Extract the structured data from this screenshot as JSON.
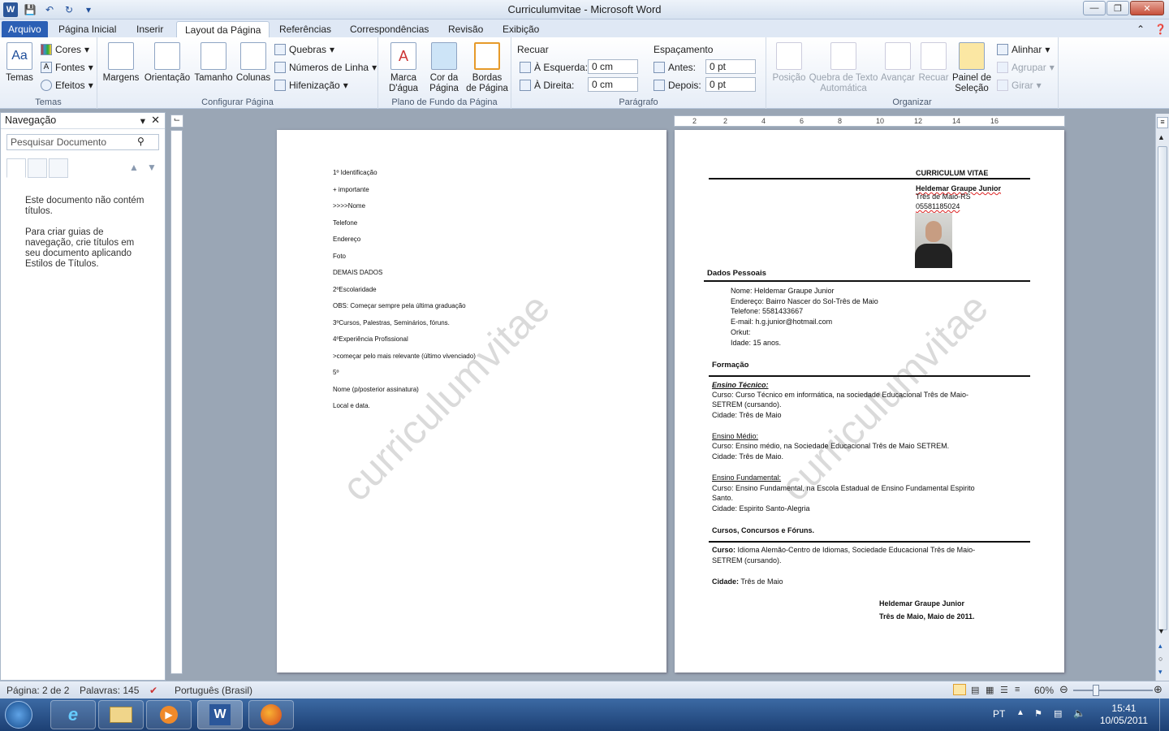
{
  "window": {
    "title": "Curriculumvitae - Microsoft Word"
  },
  "tabs": [
    {
      "label": "Arquivo"
    },
    {
      "label": "Página Inicial"
    },
    {
      "label": "Inserir"
    },
    {
      "label": "Layout da Página"
    },
    {
      "label": "Referências"
    },
    {
      "label": "Correspondências"
    },
    {
      "label": "Revisão"
    },
    {
      "label": "Exibição"
    }
  ],
  "ribbon": {
    "temas": {
      "label": "Temas",
      "btn": "Temas",
      "cores": "Cores",
      "fontes": "Fontes",
      "efeitos": "Efeitos"
    },
    "config": {
      "label": "Configurar Página",
      "margens": "Margens",
      "orientacao": "Orientação",
      "tamanho": "Tamanho",
      "colunas": "Colunas",
      "quebras": "Quebras",
      "numeros": "Números de Linha",
      "hifen": "Hifenização"
    },
    "fundo": {
      "label": "Plano de Fundo da Página",
      "marca1": "Marca",
      "marca2": "D'água",
      "cor1": "Cor da",
      "cor2": "Página",
      "bordas1": "Bordas",
      "bordas2": "de Página"
    },
    "paragrafo": {
      "label": "Parágrafo",
      "recuar": "Recuar",
      "esq": "À Esquerda:",
      "esq_val": "0 cm",
      "dir": "À Direita:",
      "dir_val": "0 cm",
      "espacamento": "Espaçamento",
      "antes": "Antes:",
      "antes_val": "0 pt",
      "depois": "Depois:",
      "depois_val": "0 pt"
    },
    "organizar": {
      "label": "Organizar",
      "posicao": "Posição",
      "quebra1": "Quebra de Texto",
      "quebra2": "Automática",
      "avancar": "Avançar",
      "recuar": "Recuar",
      "painel1": "Painel de",
      "painel2": "Seleção",
      "alinhar": "Alinhar",
      "agrupar": "Agrupar",
      "girar": "Girar"
    }
  },
  "nav": {
    "title": "Navegação",
    "search_placeholder": "Pesquisar Documento",
    "msg1": "Este documento não contém títulos.",
    "msg2": "Para criar guias de navegação, crie títulos em seu documento aplicando Estilos de Títulos."
  },
  "ruler": [
    "2",
    "2",
    "4",
    "6",
    "8",
    "10",
    "12",
    "14",
    "16"
  ],
  "page1": {
    "watermark": "curriculumvitae",
    "lines": [
      "1º Identificação",
      "+ importante",
      ">>>>Nome",
      "Telefone",
      "Endereço",
      "Foto",
      "DEMAIS DADOS",
      "2ºEscolaridade",
      "OBS: Começar sempre pela última graduação",
      "3ºCursos, Palestras, Seminários, fóruns.",
      "4ºExperiência Profissional",
      ">começar pelo mais relevante (último vivenciado)",
      "5º",
      "Nome (p/posterior assinatura)",
      "Local e data."
    ]
  },
  "page2": {
    "watermark": "curriculumvitae",
    "title": "CURRICULUM VITAE",
    "name": "Heldemar Graupe Junior",
    "city": "Três de Maio-RS",
    "phone": "05581185024",
    "dados_h": "Dados Pessoais",
    "nome": "Nome: Heldemar Graupe Junior",
    "endereco": "Endereço: Bairro Nascer do Sol-Três de Maio",
    "telefone": "Telefone: 5581433667",
    "email": "E-mail: h.g.junior@hotmail.com",
    "orkut": "Orkut:",
    "idade": "Idade: 15 anos.",
    "formacao_h": "Formação",
    "tec_h": "Ensino Técnico:",
    "tec_c1": "Curso: Curso Técnico em informática, na sociedade Educacional Três de Maio-",
    "tec_c2": "SETREM (cursando).",
    "tec_city": "Cidade: Três de Maio",
    "med_h": "Ensino Médio:",
    "med_c": "Curso: Ensino médio, na Sociedade Educacional Três de Maio SETREM.",
    "med_city": "Cidade: Três de Maio.",
    "fun_h": "Ensino Fundamental:",
    "fun_c1": "Curso: Ensino Fundamental, na Escola Estadual de Ensino Fundamental Espirito",
    "fun_c2": "Santo.",
    "fun_city": "Cidade: Espirito Santo-Alegria",
    "cursos_h": "Cursos, Concursos e Fóruns.",
    "cur_lbl": "Curso:",
    "cur_c1": " Idioma Alemão-Centro de Idiomas, Sociedade Educacional Três de Maio-",
    "cur_c2": "SETREM (cursando).",
    "cid_lbl": "Cidade:",
    "cid_val": " Três de Maio",
    "sig_name": "Heldemar Graupe Junior",
    "sig_date": "Três de Maio, Maio de 2011."
  },
  "status": {
    "pagina": "Página: 2 de 2",
    "palavras": "Palavras: 145",
    "idioma": "Português (Brasil)",
    "zoom": "60%"
  },
  "taskbar": {
    "lang": "PT",
    "time": "15:41",
    "date": "10/05/2011"
  }
}
